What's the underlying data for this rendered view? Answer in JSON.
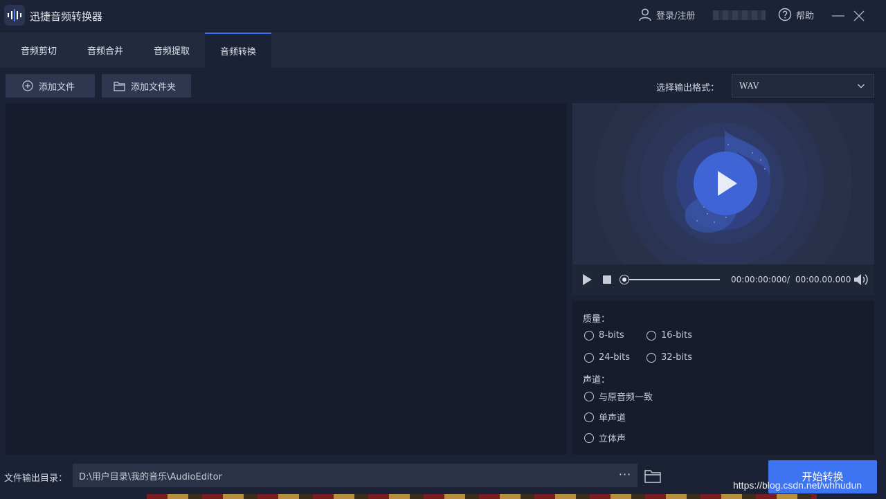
{
  "app": {
    "title": "迅捷音频转换器"
  },
  "header": {
    "login_label": "登录/注册",
    "help_label": "帮助"
  },
  "tabs": [
    {
      "label": "音频剪切"
    },
    {
      "label": "音频合并"
    },
    {
      "label": "音频提取"
    },
    {
      "label": "音频转换"
    }
  ],
  "toolbar": {
    "add_file_label": "添加文件",
    "add_folder_label": "添加文件夹",
    "format_label": "选择输出格式：",
    "format_value": "WAV"
  },
  "player": {
    "time_current": "00:00:00:000",
    "time_separator": "/",
    "time_total": "00:00.00.000",
    "progress": 0
  },
  "settings": {
    "quality_label": "质量：",
    "quality_options": [
      "8-bits",
      "16-bits",
      "24-bits",
      "32-bits"
    ],
    "channel_label": "声道：",
    "channel_options": [
      "与原音频一致",
      "单声道",
      "立体声"
    ]
  },
  "output": {
    "dir_label": "文件输出目录：",
    "dir_path": "D:\\用户目录\\我的音乐\\AudioEditor",
    "more_label": "···",
    "start_label": "开始转换"
  },
  "watermark": "https://blog.csdn.net/whhudun",
  "colors": {
    "accent": "#3e74f2",
    "background": "#1b2235",
    "panel": "#161c2d"
  }
}
